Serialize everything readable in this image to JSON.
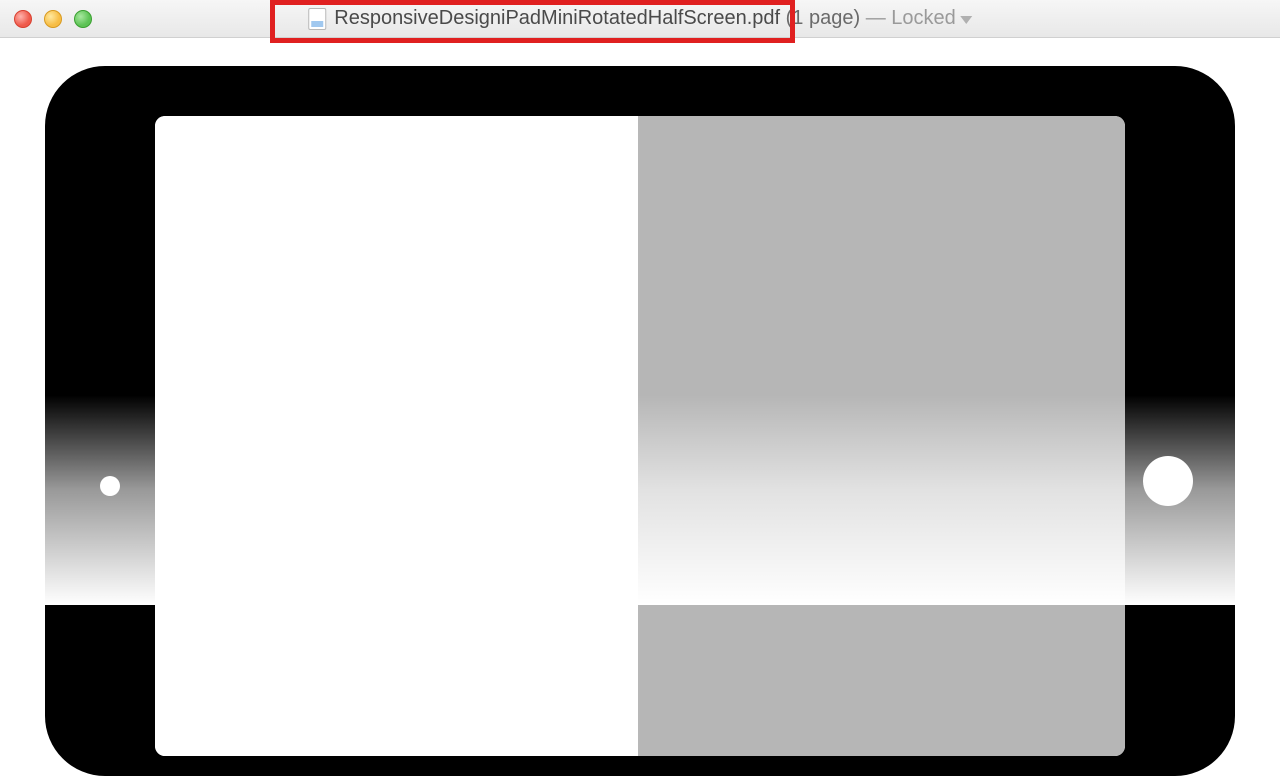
{
  "titlebar": {
    "filename_base": "ResponsiveDesigniPadMiniRotatedHalfScreen",
    "filename_ext": ".pdf",
    "page_count_text": "(1 page)",
    "separator": "—",
    "locked_label": "Locked"
  }
}
